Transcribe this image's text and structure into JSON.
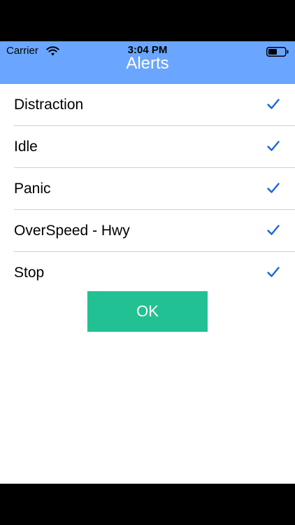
{
  "status_bar": {
    "carrier": "Carrier",
    "time": "3:04 PM",
    "wifi_icon": "wifi-icon",
    "battery_icon": "battery-icon"
  },
  "nav": {
    "title": "Alerts"
  },
  "alerts": [
    {
      "label": "Distraction",
      "checked": true
    },
    {
      "label": "Idle",
      "checked": true
    },
    {
      "label": "Panic",
      "checked": true
    },
    {
      "label": "OverSpeed - Hwy",
      "checked": true
    },
    {
      "label": "Stop",
      "checked": true
    }
  ],
  "actions": {
    "ok_label": "OK"
  },
  "colors": {
    "nav_background": "#6aa6ff",
    "checkmark": "#1a66d9",
    "ok_button": "#22c193",
    "separator": "#cfcfd4"
  }
}
